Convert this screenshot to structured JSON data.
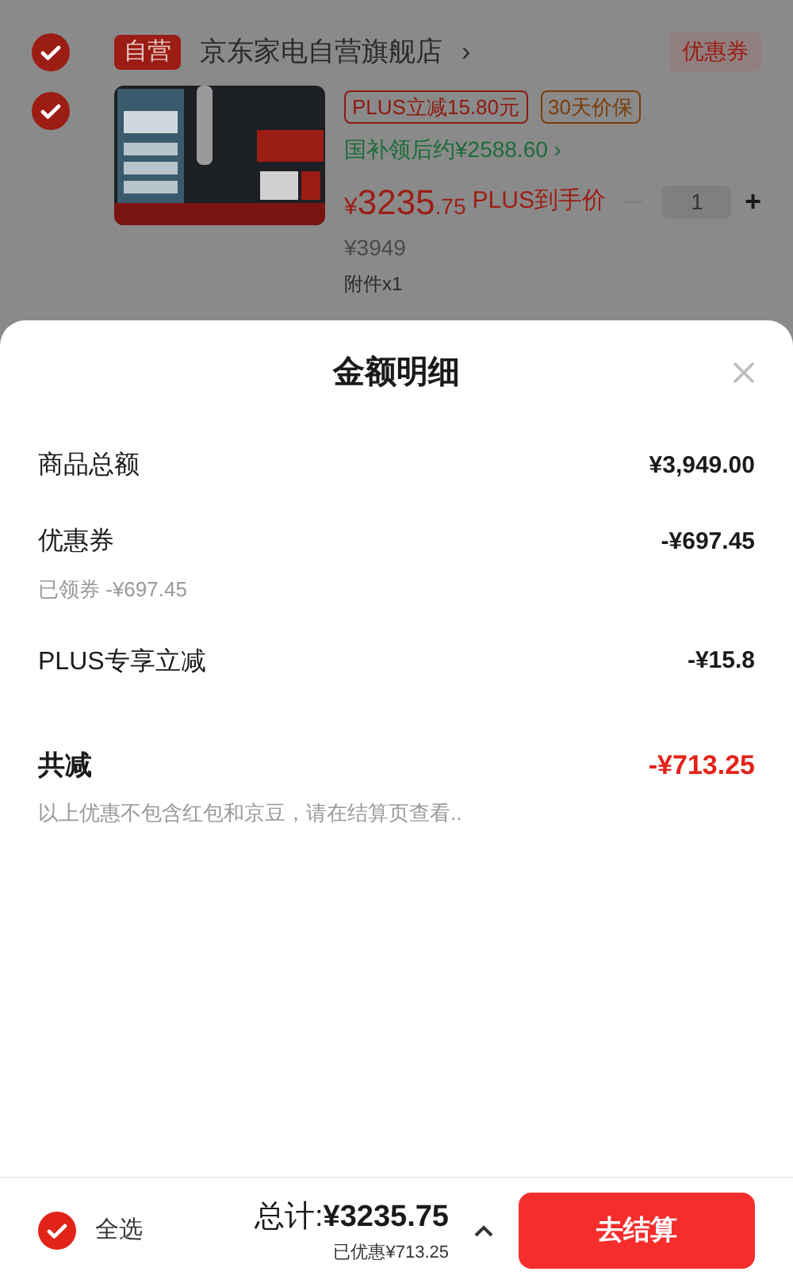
{
  "store": {
    "checked": true,
    "badge": "自营",
    "name": "京东家电自营旗舰店",
    "chevron": "›",
    "coupon": "优惠券"
  },
  "item": {
    "checked": true,
    "tags": [
      {
        "text": "PLUS立减15.80元",
        "color": "#8e1a12"
      },
      {
        "text": "30天价保",
        "color": "#7a3f0c"
      }
    ],
    "subsidy": "国补领后约¥2588.60",
    "subsidy_chevron": "›",
    "price_symbol": "¥",
    "price_int": "3235",
    "price_dec": ".75",
    "price_label": "PLUS到手价",
    "original": "¥3949",
    "qty": "1",
    "plus": "+",
    "accessory": "附件x1"
  },
  "sheet": {
    "title": "金额明细",
    "rows": [
      {
        "kind": "normal",
        "label": "商品总额",
        "value": "¥3,949.00"
      },
      {
        "kind": "normal",
        "label": "优惠券",
        "value": "-¥697.45",
        "note": "已领券 -¥697.45"
      },
      {
        "kind": "normal",
        "label": "PLUS专享立减",
        "value": "-¥15.8"
      },
      {
        "kind": "total",
        "label": "共减",
        "value": "-¥713.25",
        "note": "以上优惠不包含红包和京豆，请在结算页查看.."
      }
    ]
  },
  "bottom": {
    "select_all": {
      "label": "全选",
      "checked": true
    },
    "total_label": "总计:",
    "total": "¥3235.75",
    "saved": "已优惠¥713.25",
    "checkout": "去结算"
  }
}
